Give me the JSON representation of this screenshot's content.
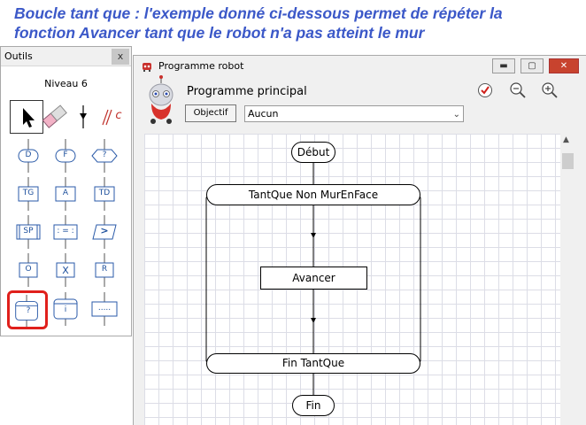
{
  "heading": {
    "line1": "Boucle tant que : l'exemple donné ci-dessous permet de répéter la",
    "line2": "fonction Avancer tant que le robot n'a pas atteint le mur"
  },
  "colors": {
    "heading": "#3b58c8",
    "highlight": "#e0201c",
    "block_label": "#1d4f9c"
  },
  "outils": {
    "title": "Outils",
    "close": "x",
    "niveau": "Niveau 6",
    "tools": [
      {
        "name": "select-arrow",
        "label": ""
      },
      {
        "name": "eraser",
        "label": ""
      },
      {
        "name": "connector",
        "label": ""
      },
      {
        "name": "comment",
        "label": "//c"
      },
      {
        "name": "debut-block",
        "label": "D"
      },
      {
        "name": "fin-block",
        "label": "F"
      },
      {
        "name": "condition-block",
        "label": "?"
      },
      {
        "name": "turn-left-block",
        "label": "TG"
      },
      {
        "name": "avancer-block",
        "label": "A"
      },
      {
        "name": "turn-right-block",
        "label": "TD"
      },
      {
        "name": "subprogram-block",
        "label": "SP"
      },
      {
        "name": "assignment-block",
        "label": ": = :"
      },
      {
        "name": "output-block",
        "label": ">"
      },
      {
        "name": "o-block",
        "label": "O"
      },
      {
        "name": "x-block",
        "label": "X"
      },
      {
        "name": "r-block",
        "label": "R"
      },
      {
        "name": "while-loop-block",
        "label": "?"
      },
      {
        "name": "repeat-loop-block",
        "label": "i"
      },
      {
        "name": "generic-block",
        "label": "....."
      }
    ]
  },
  "prog": {
    "title": "Programme robot",
    "main_title": "Programme principal",
    "objectif_label": "Objectif",
    "combo_value": "Aucun",
    "minimize": "▬",
    "maximize": "▢",
    "close": "✕"
  },
  "flow": {
    "debut": "Début",
    "tantque": "TantQue Non MurEnFace",
    "avancer": "Avancer",
    "fin_tantque": "Fin TantQue",
    "fin": "Fin"
  }
}
